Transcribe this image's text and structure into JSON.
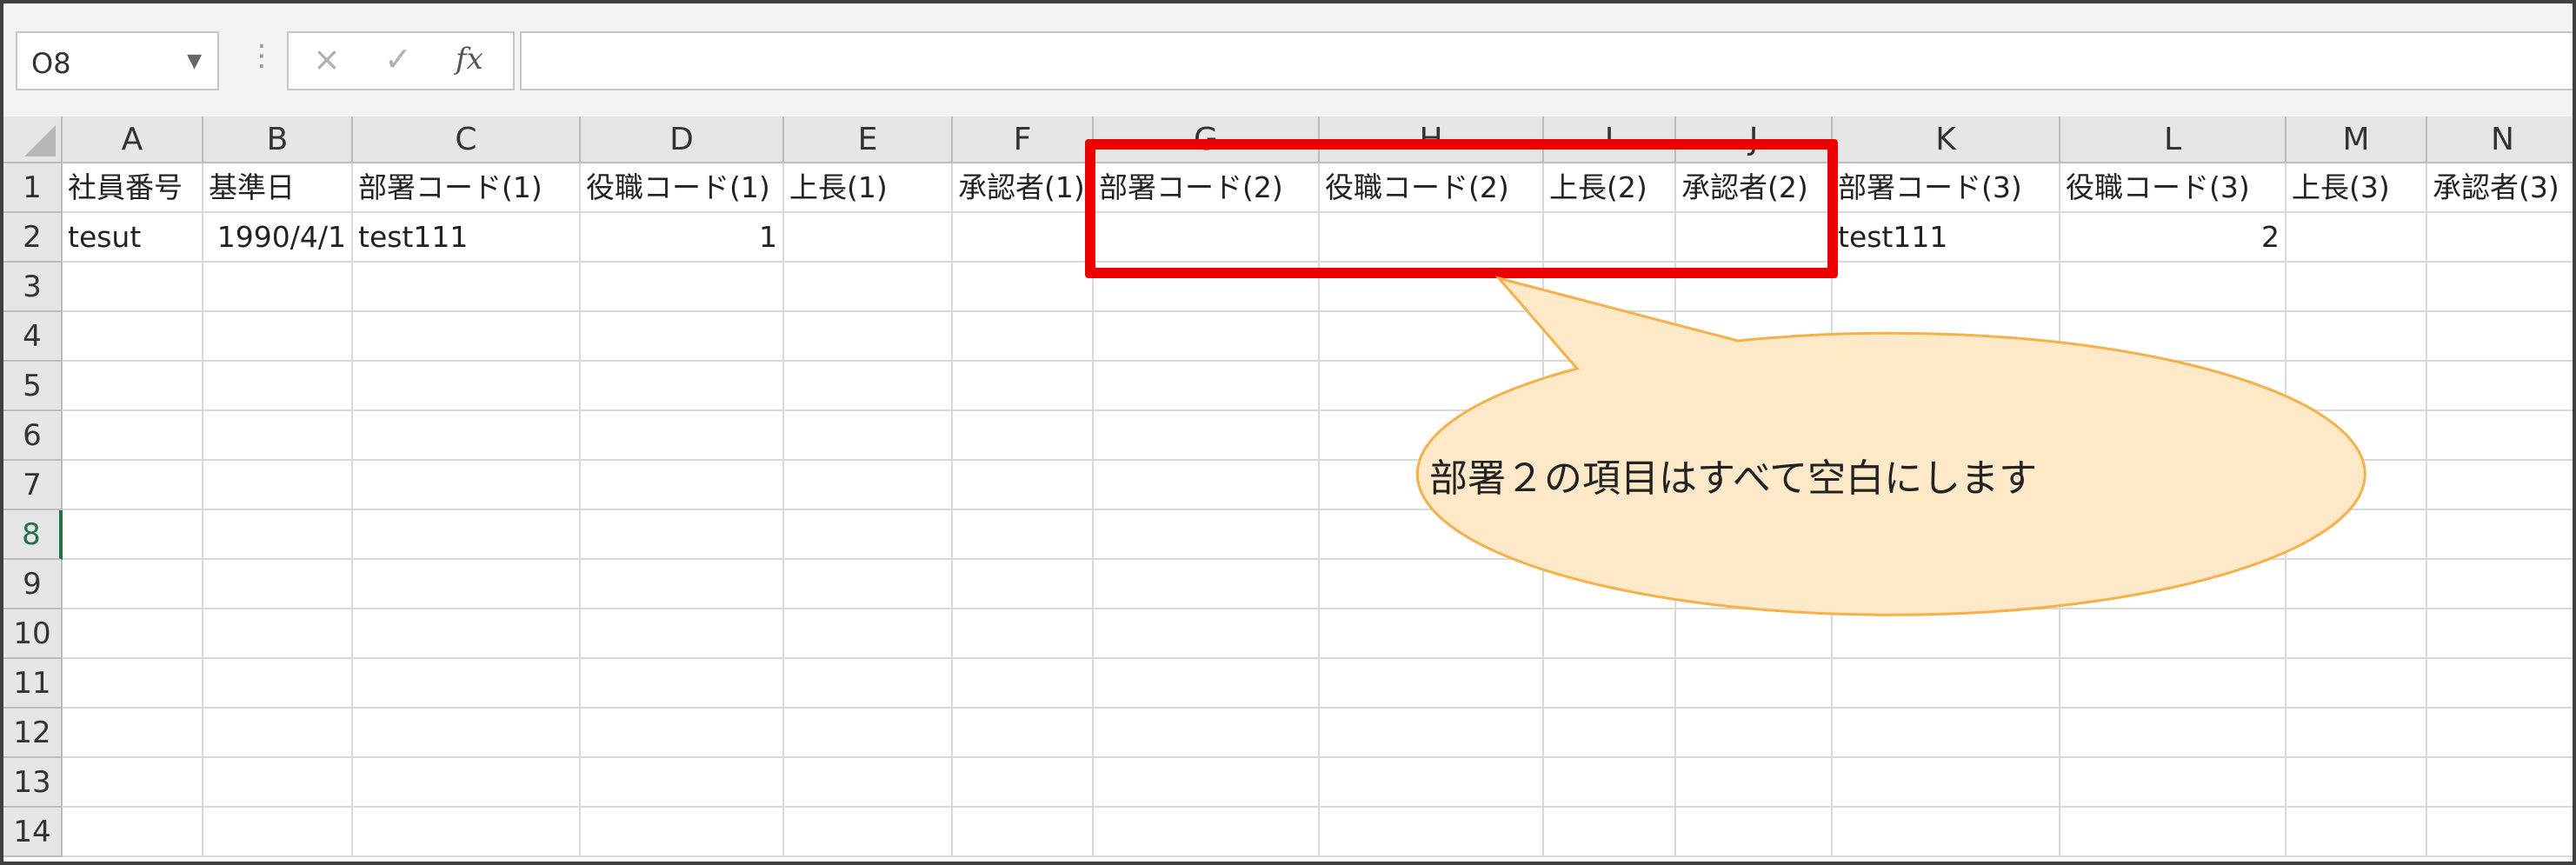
{
  "formula_bar": {
    "name_box": "O8",
    "cancel_icon": "×",
    "enter_icon": "✓",
    "fx_label": "fx",
    "formula_value": ""
  },
  "grid": {
    "columns": [
      "A",
      "B",
      "C",
      "D",
      "E",
      "F",
      "G",
      "H",
      "I",
      "J",
      "K",
      "L",
      "M",
      "N"
    ],
    "rows": [
      "1",
      "2",
      "3",
      "4",
      "5",
      "6",
      "7",
      "8",
      "9",
      "10",
      "11",
      "12",
      "13",
      "14"
    ],
    "row1": [
      "社員番号",
      "基準日",
      "部署コード(1)",
      "役職コード(1)",
      "上長(1)",
      "承認者(1)",
      "部署コード(2)",
      "役職コード(2)",
      "上長(2)",
      "承認者(2)",
      "部署コード(3)",
      "役職コード(3)",
      "上長(3)",
      "承認者(3)"
    ],
    "row2": [
      "tesut",
      "1990/4/1",
      "test111",
      "1",
      "",
      "",
      "",
      "",
      "",
      "",
      "test111",
      "2",
      "",
      ""
    ],
    "selected_row": "8",
    "active_cell": "O8"
  },
  "annotation": {
    "callout_text": "部署２の項目はすべて空白にします",
    "callout_fill": "#fde9c8",
    "callout_stroke": "#f5b04a",
    "highlight_color": "#ee0000"
  }
}
